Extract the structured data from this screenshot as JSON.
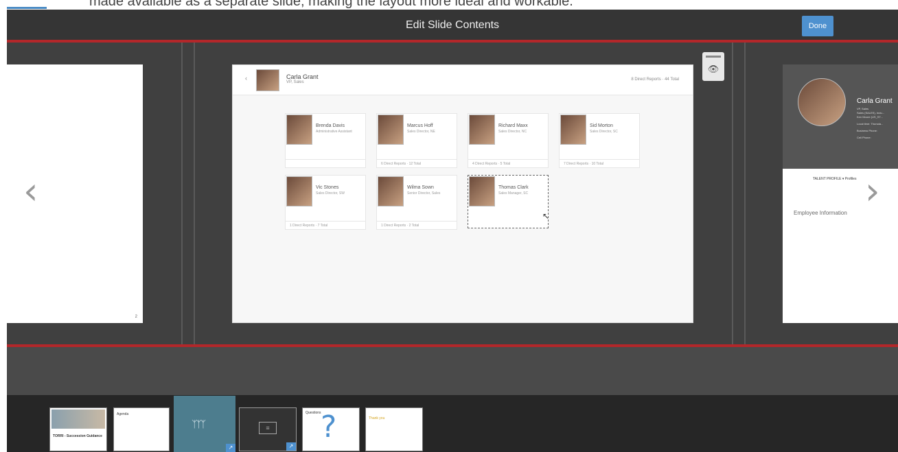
{
  "top_caption": "made available as a separate slide, making the layout more ideal and workable.",
  "header": {
    "title": "Edit Slide Contents",
    "done_label": "Done"
  },
  "nav": {
    "prev_glyph": "‹",
    "next_glyph": "›"
  },
  "left_slide": {
    "page_number": "2"
  },
  "main_slide": {
    "manager": {
      "name": "Carla Grant",
      "role": "VP, Sales",
      "reports": "8 Direct Reports · 44 Total"
    },
    "employees": [
      {
        "name": "Brenda Davis",
        "role": "Administrative Assistant",
        "reports": ""
      },
      {
        "name": "Marcus Hoff",
        "role": "Sales Director, NE",
        "reports": "6 Direct Reports · 12 Total"
      },
      {
        "name": "Richard Maxx",
        "role": "Sales Director, NC",
        "reports": "4 Direct Reports · 5 Total"
      },
      {
        "name": "Sid Morton",
        "role": "Sales Director, SC",
        "reports": "7 Direct Reports · 10 Total"
      },
      {
        "name": "Vic Stones",
        "role": "Sales Director, SW",
        "reports": "1 Direct Reports · 7 Total"
      },
      {
        "name": "Wilma Sown",
        "role": "Senior Director, Sales",
        "reports": "1 Direct Reports · 2 Total"
      },
      {
        "name": "Thomas Clark",
        "role": "Sales Manager, SC",
        "reports": ""
      }
    ]
  },
  "right_slide": {
    "name": "Carla Grant",
    "details": [
      "VP, Sales",
      "Sales (SALES), Indu...",
      "Ken Moore (US_ST...",
      "Local time: Thursda...",
      "Business Phone:",
      "Cell Phone:"
    ],
    "tabs": "TALENT PROFILE  ▾   Profiles",
    "section": "Employee Information"
  },
  "filmstrip": {
    "thumbs": [
      {
        "title": "TORRI - Succession Guidance"
      },
      {
        "title": "Agenda"
      },
      {
        "title": ""
      },
      {
        "title": ""
      },
      {
        "title": "Questions"
      },
      {
        "title": "Thank you"
      }
    ],
    "badge_glyph": "↗"
  },
  "colors": {
    "accent": "#4e91cf",
    "red": "#b3272a",
    "bg": "#3d3d3d"
  }
}
